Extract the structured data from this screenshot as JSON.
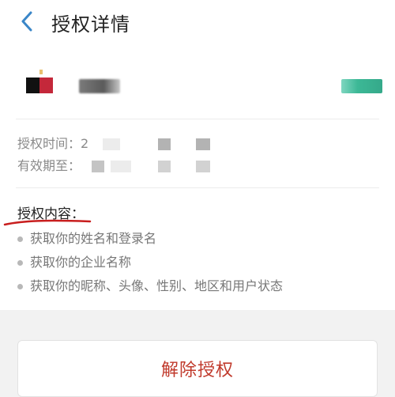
{
  "header": {
    "back_icon": "chevron-left-icon",
    "title": "授权详情"
  },
  "app": {
    "icon_colors": [
      "#111111",
      "#c4283a"
    ],
    "status_color": "#3cb896"
  },
  "info": {
    "auth_time_label": "授权时间：",
    "auth_time_value_visible": "2",
    "valid_until_label": "有效期至："
  },
  "permissions": {
    "title": "授权内容：",
    "items": [
      "获取你的姓名和登录名",
      "获取你的企业名称",
      "获取你的昵称、头像、性别、地区和用户状态"
    ]
  },
  "actions": {
    "revoke_label": "解除授权",
    "revoke_color": "#c0392b"
  },
  "colors": {
    "accent_blue": "#3a86c8",
    "annotation_red": "#c81e1e"
  }
}
